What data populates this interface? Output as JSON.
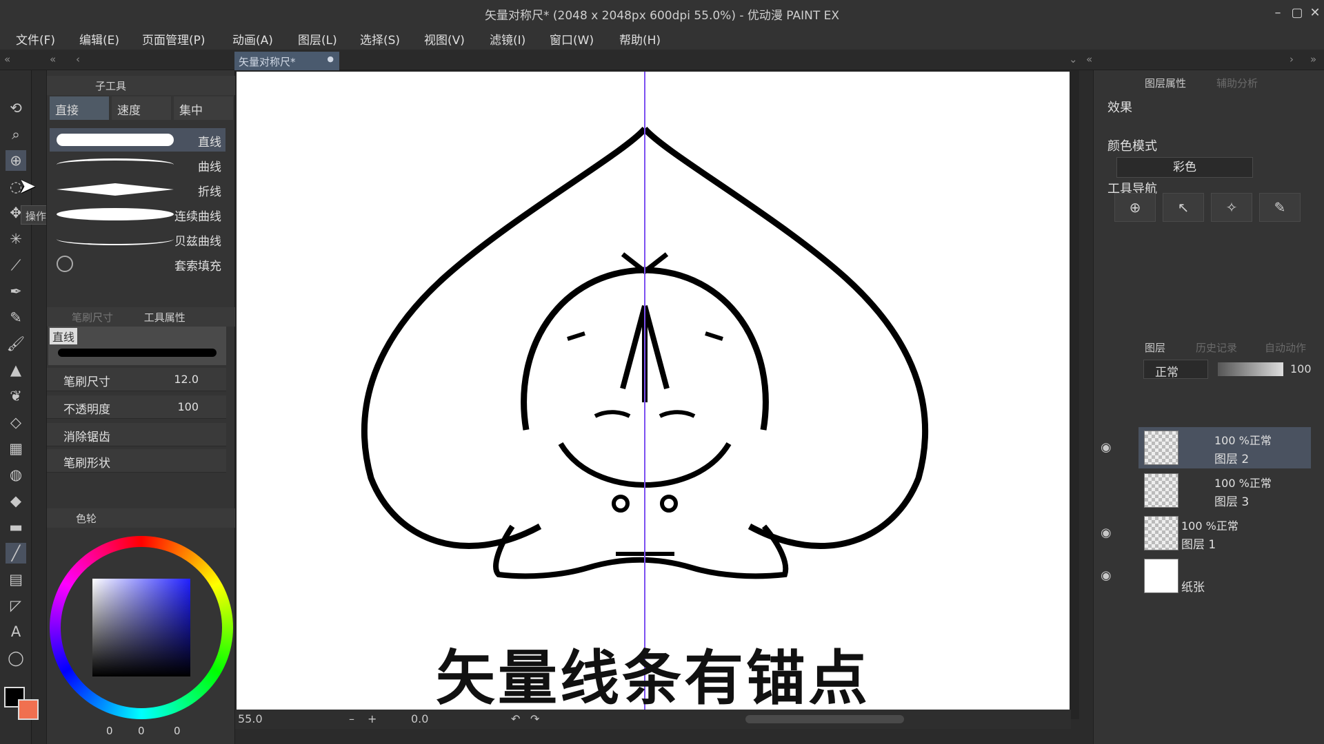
{
  "window": {
    "title": "矢量对称尺* (2048 x 2048px 600dpi 55.0%)  - 优动漫 PAINT EX"
  },
  "menu": [
    "文件(F)",
    "编辑(E)",
    "页面管理(P)",
    "动画(A)",
    "图层(L)",
    "选择(S)",
    "视图(V)",
    "滤镜(I)",
    "窗口(W)",
    "帮助(H)"
  ],
  "document_tab": {
    "label": "矢量对称尺*"
  },
  "tooltip": "操作",
  "left_panel": {
    "subtool_header": "子工具",
    "subtool_tabs": [
      "直接",
      "速度",
      "集中"
    ],
    "brushes": [
      "直线",
      "曲线",
      "折线",
      "连续曲线",
      "贝兹曲线",
      "套索填充"
    ],
    "prop_tabs": [
      "笔刷尺寸",
      "工具属性"
    ],
    "current_tool": "直线",
    "props": [
      {
        "label": "笔刷尺寸",
        "value": "12.0"
      },
      {
        "label": "不透明度",
        "value": "100"
      },
      {
        "label": "消除锯齿",
        "value": ""
      },
      {
        "label": "笔刷形状",
        "value": ""
      }
    ],
    "color_header": "色轮",
    "rgb": [
      "0",
      "0",
      "0"
    ]
  },
  "canvas": {
    "caption": "矢量线条有锚点",
    "accent": "#7b4ff0"
  },
  "statusbar": {
    "zoom": "55.0",
    "rotation": "0.0"
  },
  "right_panel": {
    "tabs": [
      "图层属性",
      "辅助分析"
    ],
    "effect_title": "效果",
    "color_mode_title": "颜色模式",
    "color_mode_value": "彩色",
    "tool_nav_title": "工具导航",
    "layer_tabs": [
      "图层",
      "历史记录",
      "自动动作"
    ],
    "blend_mode": "正常",
    "opacity": "100",
    "layers": [
      {
        "blend": "100 %正常",
        "name": "图层 2"
      },
      {
        "blend": "100 %正常",
        "name": "图层 3"
      },
      {
        "blend": "100 %正常",
        "name": "图层 1"
      },
      {
        "blend": "",
        "name": "纸张"
      }
    ]
  }
}
